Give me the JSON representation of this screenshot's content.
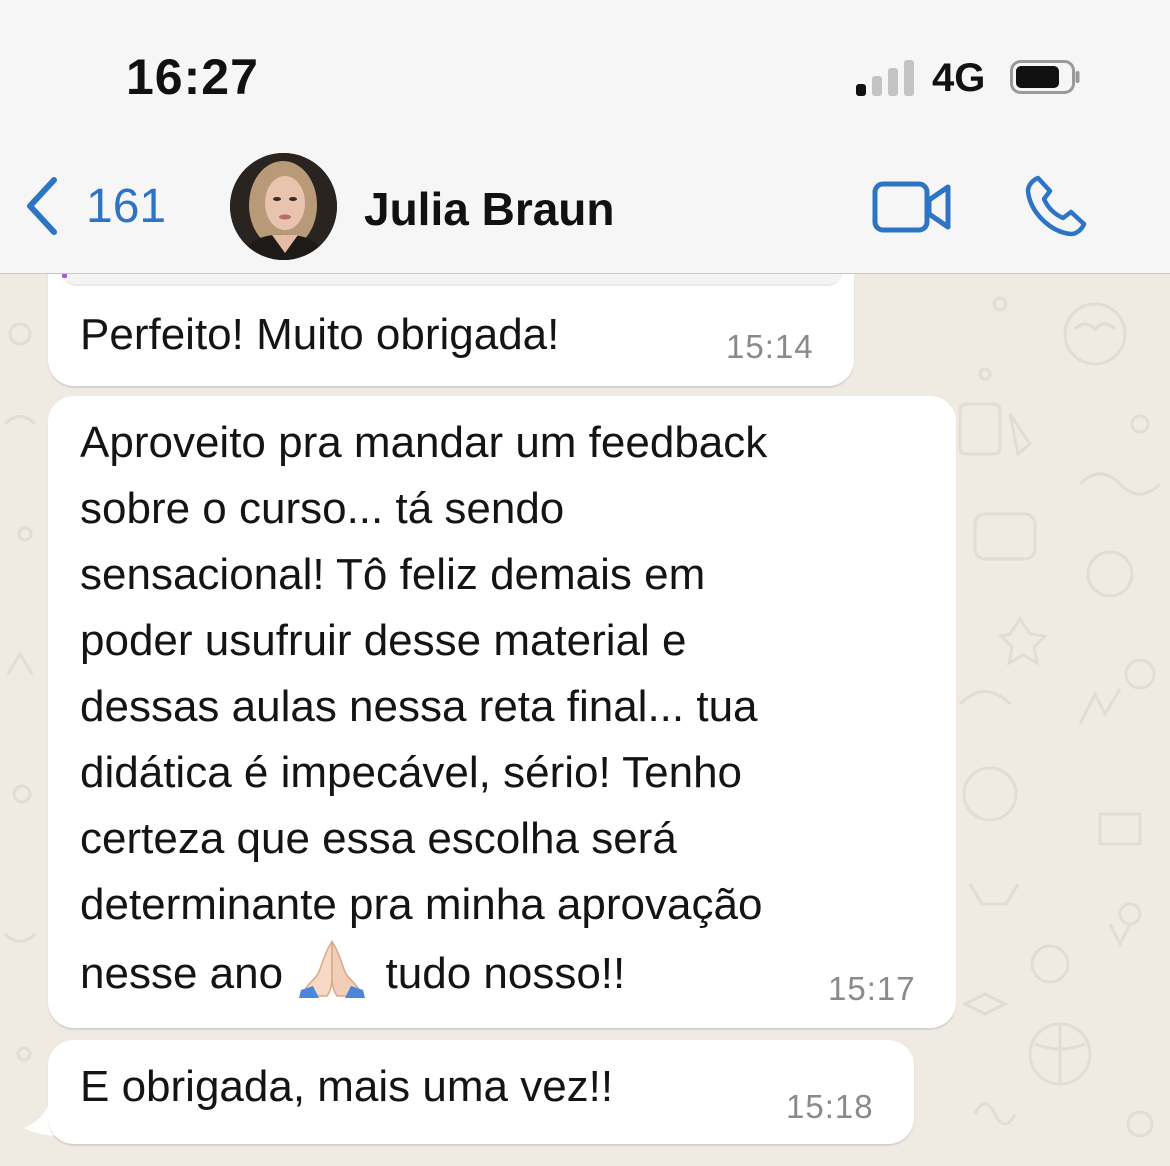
{
  "status_bar": {
    "time": "16:27",
    "network": "4G",
    "signal_bars_active": 1,
    "signal_bars_total": 4
  },
  "header": {
    "back_count": "161",
    "contact_name": "Julia Braun",
    "icons": {
      "back": "chevron-left-icon",
      "video": "video-camera-icon",
      "call": "phone-icon"
    },
    "accent_color": "#2d75c4"
  },
  "messages": [
    {
      "text": "Perfeito! Muito obrigada!",
      "time": "15:14"
    },
    {
      "lines": [
        "Aproveito pra mandar um feedback",
        "sobre o curso... tá sendo",
        "sensacional! Tô feliz demais em",
        "poder usufruir desse material e",
        "dessas aulas nessa reta final... tua",
        "didática é impecável, sério! Tenho",
        "certeza que essa escolha será",
        "determinante pra minha aprovação"
      ],
      "last_line_before_emoji": "nesse ano",
      "emoji": "folded-hands-emoji",
      "last_line_after_emoji": "tudo nosso!!",
      "time": "15:17"
    },
    {
      "text": "E obrigada, mais uma vez!!",
      "time": "15:18"
    }
  ],
  "colors": {
    "chat_background": "#efeae2",
    "bubble_incoming": "#ffffff",
    "bar_background": "#f6f6f6"
  }
}
